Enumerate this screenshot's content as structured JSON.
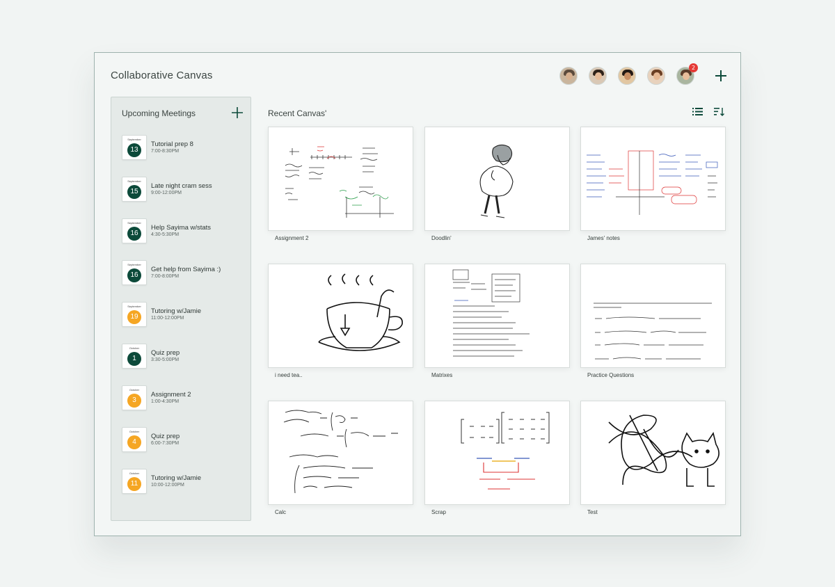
{
  "app": {
    "title": "Collaborative Canvas"
  },
  "header": {
    "avatars": [
      {
        "name": "avatar-1",
        "bg": "#c9b59d",
        "hair": "#5b4a3c",
        "face": "#d7b08f",
        "badge": null
      },
      {
        "name": "avatar-2",
        "bg": "#d9c8b5",
        "hair": "#2f2219",
        "face": "#e6bb98",
        "badge": null
      },
      {
        "name": "avatar-3",
        "bg": "#e2c7a2",
        "hair": "#231914",
        "face": "#c98f64",
        "badge": null
      },
      {
        "name": "avatar-4",
        "bg": "#e8d2bd",
        "hair": "#6b3f24",
        "face": "#e7b995",
        "badge": null
      },
      {
        "name": "avatar-5",
        "bg": "#a9b59f",
        "hair": "#5a3b2a",
        "face": "#e8bd9b",
        "badge": "2"
      }
    ],
    "add_icon": "plus-icon"
  },
  "sidebar": {
    "title": "Upcoming Meetings",
    "meetings": [
      {
        "month": "September",
        "day": "13",
        "color": "green",
        "title": "Tutorial prep 8",
        "time": "7:00-8:30PM"
      },
      {
        "month": "September",
        "day": "15",
        "color": "green",
        "title": "Late night cram sess",
        "time": "9:00-12:00PM"
      },
      {
        "month": "September",
        "day": "16",
        "color": "green",
        "title": "Help Sayima w/stats",
        "time": "4:30-5:30PM"
      },
      {
        "month": "September",
        "day": "16",
        "color": "green",
        "title": "Get help from Sayima :)",
        "time": "7:00-8:00PM"
      },
      {
        "month": "September",
        "day": "19",
        "color": "orange",
        "title": "Tutoring w/Jamie",
        "time": "11:00-12:00PM"
      },
      {
        "month": "October",
        "day": "1",
        "color": "green",
        "title": "Quiz prep",
        "time": "3:30-5:00PM"
      },
      {
        "month": "October",
        "day": "3",
        "color": "orange",
        "title": "Assignment 2",
        "time": "1:00-4:30PM"
      },
      {
        "month": "October",
        "day": "4",
        "color": "orange",
        "title": "Quiz prep",
        "time": "6:00-7:30PM"
      },
      {
        "month": "October",
        "day": "11",
        "color": "orange",
        "title": "Tutoring w/Jamie",
        "time": "10:00-12:00PM"
      }
    ]
  },
  "main": {
    "title": "Recent Canvas'",
    "view_icons": [
      "list-view-icon",
      "sort-icon"
    ],
    "canvases": [
      {
        "label": "Assignment 2",
        "kind": "math"
      },
      {
        "label": "Doodlin'",
        "kind": "person"
      },
      {
        "label": "James' notes",
        "kind": "notes"
      },
      {
        "label": "i need tea..",
        "kind": "tea"
      },
      {
        "label": "Matrixes",
        "kind": "matrix-notes"
      },
      {
        "label": "Practice Questions",
        "kind": "questions"
      },
      {
        "label": "Calc",
        "kind": "calc"
      },
      {
        "label": "Scrap",
        "kind": "scrap"
      },
      {
        "label": "Test",
        "kind": "cat"
      }
    ]
  },
  "theme": {
    "accent": "#0c4a3a",
    "orange": "#f5a623",
    "badge": "#e53935"
  }
}
